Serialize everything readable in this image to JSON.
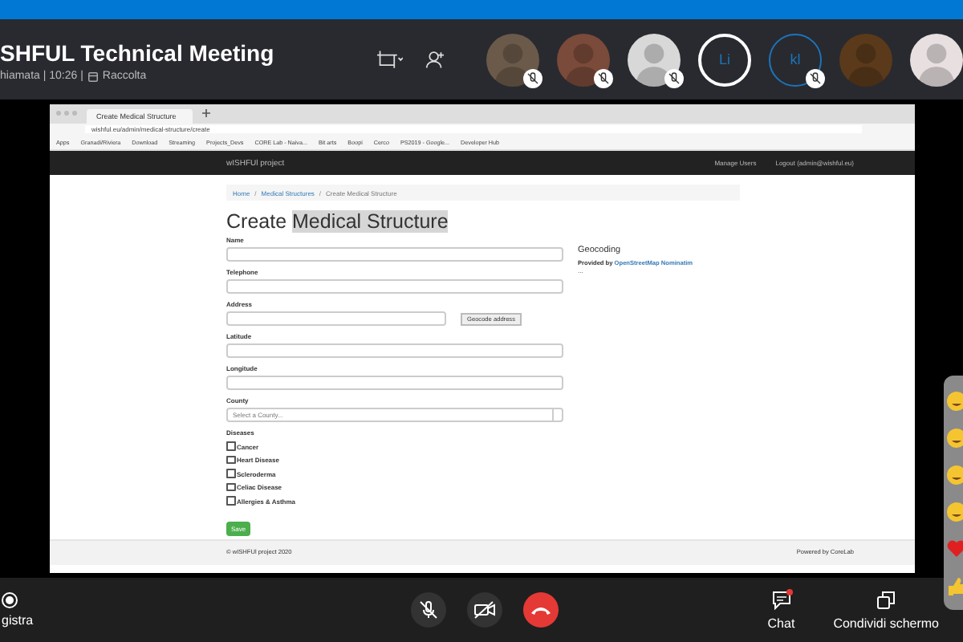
{
  "call": {
    "title": "SHFUL Technical Meeting",
    "subtitle": "hiamata | 10:26 |",
    "collection": "Raccolta"
  },
  "participants": [
    {
      "kind": "photo",
      "muted": true,
      "color": "#6b5a4a"
    },
    {
      "kind": "photo",
      "muted": true,
      "color": "#7a4a3a"
    },
    {
      "kind": "photo",
      "muted": true,
      "color": "#d8d8d8"
    },
    {
      "kind": "initials",
      "initials": "Li",
      "muted": false,
      "speaking": true,
      "color": "#1b75bb"
    },
    {
      "kind": "initials",
      "initials": "kl",
      "muted": true,
      "speaking": false,
      "color": "#1b75bb"
    },
    {
      "kind": "photo",
      "muted": false,
      "color": "#5a3a1a"
    },
    {
      "kind": "photo",
      "muted": false,
      "color": "#e8e0e0"
    }
  ],
  "browser": {
    "tab": "Create Medical Structure",
    "url": "wishful.eu/admin/medical-structure/create",
    "bookmarks": [
      "Apps",
      "Granadi/Riviera",
      "Download",
      "Streaming",
      "Projects_Devs",
      "CORE Lab - Naiva...",
      "Bit arts",
      "Boopi",
      "Cerco",
      "PS2019 - Google...",
      "Developer Hub"
    ]
  },
  "site": {
    "brand": "wISHFUl project",
    "nav": [
      "Manage Users",
      "Logout (admin@wishful.eu)"
    ],
    "breadcrumb": [
      "Home",
      "Medical Structures",
      "Create Medical Structure"
    ],
    "breadcrumb_separator": "/",
    "title": "Create",
    "title_selected": "Medical Structure",
    "fields": [
      {
        "kind": "text",
        "label": "Name"
      },
      {
        "kind": "text",
        "label": "Telephone"
      },
      {
        "kind": "address",
        "label": "Address",
        "button": "Geocode address"
      },
      {
        "kind": "text",
        "label": "Latitude"
      },
      {
        "kind": "text",
        "label": "Longitude"
      },
      {
        "kind": "select",
        "label": "County",
        "placeholder": "Select a County..."
      }
    ],
    "diseases_label": "Diseases",
    "diseases": [
      {
        "label": "Cancer",
        "checked": false
      },
      {
        "label": "Heart Disease",
        "checked": false
      },
      {
        "label": "Scleroderma",
        "checked": false
      },
      {
        "label": "Celiac Disease",
        "checked": false
      },
      {
        "label": "Allergies & Asthma",
        "checked": false
      }
    ],
    "save": "Save",
    "geocoding": {
      "title": "Geocoding",
      "provided": "Provided by",
      "link": "OpenStreetMap Nominatim",
      "result": "..."
    },
    "footer_left": "© wISHFUl project 2020",
    "footer_right": "Powered by CoreLab"
  },
  "controls": {
    "record": "gistra",
    "mic_muted": true,
    "video_off": true,
    "chat": "Chat",
    "chat_unread": true,
    "share": "Condividi schermo"
  },
  "reactions": [
    {
      "kind": "emoji"
    },
    {
      "kind": "emoji"
    },
    {
      "kind": "emoji"
    },
    {
      "kind": "emoji"
    },
    {
      "kind": "heart"
    },
    {
      "kind": "thumb"
    }
  ]
}
